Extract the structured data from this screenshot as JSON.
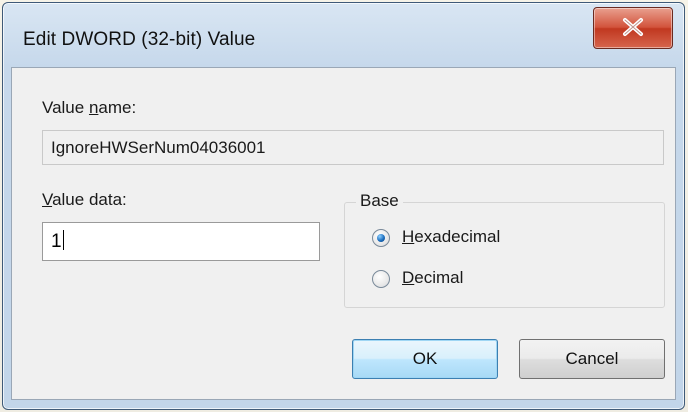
{
  "window": {
    "title": "Edit DWORD (32-bit) Value",
    "close_icon": "close-icon"
  },
  "value_name": {
    "label_before": "Value ",
    "label_underlined": "n",
    "label_after": "ame:",
    "value": "IgnoreHWSerNum04036001"
  },
  "value_data": {
    "label_underlined": "V",
    "label_after": "alue data:",
    "value": "1"
  },
  "base": {
    "label": "Base",
    "options": [
      {
        "underlined": "H",
        "rest": "exadecimal",
        "selected": true
      },
      {
        "underlined": "D",
        "rest": "ecimal",
        "selected": false
      }
    ]
  },
  "buttons": {
    "ok": "OK",
    "cancel": "Cancel"
  },
  "colors": {
    "accent": "#3c7fb1",
    "close": "#c13820"
  }
}
